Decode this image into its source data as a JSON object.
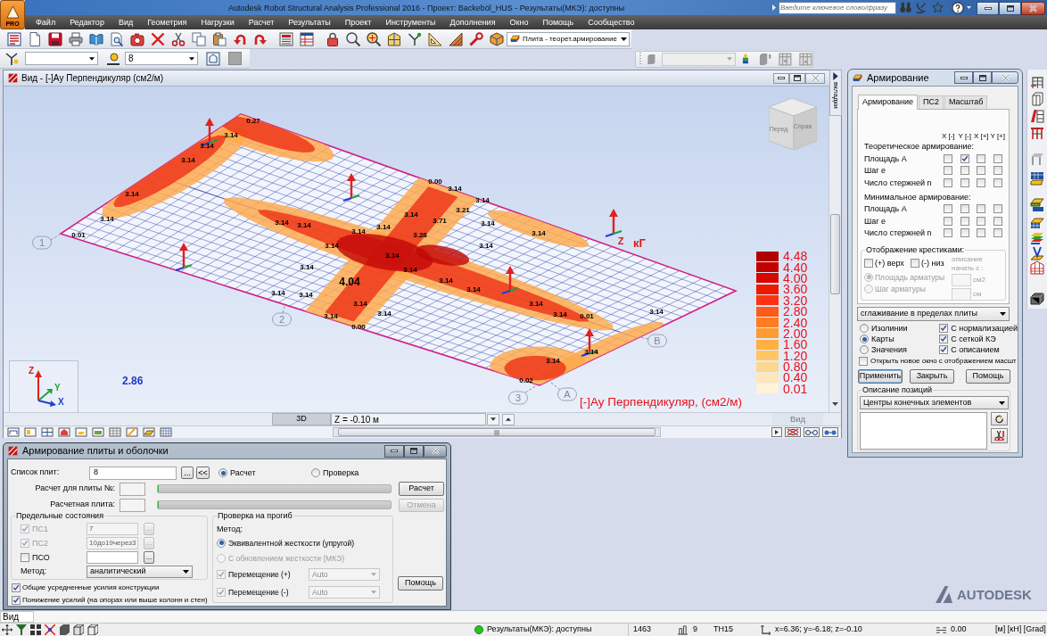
{
  "app": {
    "menu_button": "PRO",
    "title": "Autodesk Robot Structural Analysis Professional 2016 - Проект: Backeböl_HUS - Результаты(МКЭ): доступны",
    "search": {
      "placeholder": "Введите ключевое слово/фразу"
    }
  },
  "menu": [
    "Файл",
    "Редактор",
    "Вид",
    "Геометрия",
    "Нагрузки",
    "Расчет",
    "Результаты",
    "Проект",
    "Инструменты",
    "Дополнения",
    "Окно",
    "Помощь",
    "Сообщество"
  ],
  "toolbar": {
    "layout_dropdown": "Плита - теорет.армирование",
    "case_dropdown": "8"
  },
  "viewport": {
    "title": "Вид - [-]Ау Перпендикуляр (см2/м)",
    "side_tab": "вкладки",
    "view_cube": [
      "Перед",
      "Справ"
    ],
    "map_labels": [
      "0.27",
      "3.14",
      "3.14",
      "3.14",
      "0.00",
      "3.14",
      "3.14",
      "3.14",
      "3.14",
      "0.01",
      "3.14",
      "3.14",
      "3.14",
      "3.14",
      "3.14",
      "3.14",
      "3.71",
      "3.21",
      "3.28",
      "3.14",
      "3.14",
      "3.14",
      "3.14",
      "3.14",
      "4.04",
      "3.14",
      "3.14",
      "3.14",
      "3.14",
      "3.14",
      "3.14",
      "3.14",
      "0.00",
      "3.14",
      "3.14",
      "3.14",
      "0.01",
      "3.14",
      "3.14",
      "3.14",
      "0.02"
    ],
    "grid_axes": [
      "1",
      "2",
      "3",
      "A",
      "B"
    ],
    "load_labels": [
      "Z",
      "кГ"
    ],
    "triad": [
      "Z",
      "Y",
      "X"
    ],
    "scale_value": "2.86",
    "legend": {
      "title": "[-]Ау Перпендикуляр, (см2/м)",
      "items": [
        {
          "label": "4.48",
          "color": "#b00000"
        },
        {
          "label": "4.40",
          "color": "#c30000"
        },
        {
          "label": "4.00",
          "color": "#d60800"
        },
        {
          "label": "3.60",
          "color": "#ee1a00"
        },
        {
          "label": "3.20",
          "color": "#ff3312"
        },
        {
          "label": "2.80",
          "color": "#ff5a1c"
        },
        {
          "label": "2.40",
          "color": "#ff7d24"
        },
        {
          "label": "2.00",
          "color": "#ff9a30"
        },
        {
          "label": "1.60",
          "color": "#ffb042"
        },
        {
          "label": "1.20",
          "color": "#ffc662"
        },
        {
          "label": "0.80",
          "color": "#ffd690"
        },
        {
          "label": "0.40",
          "color": "#ffe6b6"
        },
        {
          "label": "0.01",
          "color": "#fff3d8"
        }
      ]
    },
    "mode": "3D",
    "level": "Z = -0.10 м",
    "view_button": "Вид"
  },
  "reinforcement_panel": {
    "title": "Армирование",
    "tabs": [
      {
        "label": "Армирование",
        "selected": true
      },
      {
        "label": "ПС2",
        "selected": false
      },
      {
        "label": "Масштаб",
        "selected": false
      }
    ],
    "columns": [
      "X [-]",
      "Y [-]",
      "X [+]",
      "Y [+]"
    ],
    "sections": [
      {
        "heading": "Теоретическое армирование:",
        "rows": [
          {
            "label": "Площадь А",
            "checks": [
              false,
              true,
              false,
              false
            ]
          },
          {
            "label": "Шаг е",
            "checks": [
              false,
              false,
              false,
              false
            ]
          },
          {
            "label": "Число стержней n",
            "checks": [
              false,
              false,
              false,
              false
            ]
          }
        ]
      },
      {
        "heading": "Минимальное армирование:",
        "rows": [
          {
            "label": "Площадь А",
            "checks": [
              false,
              false,
              false,
              false
            ]
          },
          {
            "label": "Шаг е",
            "checks": [
              false,
              false,
              false,
              false
            ]
          },
          {
            "label": "Число стержней n",
            "checks": [
              false,
              false,
              false,
              false
            ]
          }
        ]
      }
    ],
    "cross_display": {
      "title": "Отображение крестиками:",
      "options": [
        {
          "label": "(+) верх",
          "checked": false
        },
        {
          "label": "(-) низ",
          "checked": false
        }
      ],
      "description_label": "описание начать с :",
      "disabled": true,
      "radios": [
        {
          "label": "Площадь арматуры",
          "selected": true,
          "unit": "см2"
        },
        {
          "label": "Шаг арматуры",
          "selected": false,
          "unit": "см"
        }
      ]
    },
    "smoothing": "сглаживание в пределах плиты",
    "display_modes": [
      {
        "label": "Изолинии",
        "selected": false
      },
      {
        "label": "Карты",
        "selected": true
      },
      {
        "label": "Значения",
        "selected": false
      }
    ],
    "display_options": [
      {
        "label": "С нормализацией",
        "checked": true
      },
      {
        "label": "С сеткой КЭ",
        "checked": true
      },
      {
        "label": "С описанием",
        "checked": true
      }
    ],
    "new_window": {
      "label": "Открыть новое окно с отображением масшт",
      "checked": false
    },
    "buttons": [
      {
        "label": "Применить",
        "focused": true
      },
      {
        "label": "Закрыть",
        "focused": false
      },
      {
        "label": "Помощь",
        "focused": false
      }
    ],
    "positions": {
      "title": "Описание позиций",
      "dropdown": "Центры конечных элементов"
    }
  },
  "plate_dialog": {
    "title": "Армирование плиты и оболочки",
    "plate_list": {
      "label": "Список плит:",
      "value": "8",
      "browse": "...",
      "pick": "<<"
    },
    "mode": [
      {
        "label": "Расчет",
        "selected": true
      },
      {
        "label": "Проверка",
        "selected": false
      }
    ],
    "progress": [
      {
        "label": "Расчет для плиты №:",
        "level": 0,
        "action": "Расчет",
        "disabled": false
      },
      {
        "label": "Расчетная плита:",
        "level": 0,
        "action": "Отмена",
        "disabled": true
      }
    ],
    "limit_states": {
      "title": "Предельные состояния",
      "rows": [
        {
          "label": "ПС1",
          "checked": true,
          "disabled": true,
          "value": "7",
          "browse": "..."
        },
        {
          "label": "ПС2",
          "checked": true,
          "disabled": true,
          "value": "10до19через3",
          "browse": "..."
        },
        {
          "label": "ПСО",
          "checked": false,
          "disabled": false,
          "browse": "..."
        }
      ],
      "method_label": "Метод:",
      "method": "аналитический"
    },
    "options": [
      {
        "label": "Общие усредненные усилия конструкции",
        "checked": true
      },
      {
        "label": "Понижение усилий (на опорах или выше колонн и стен)",
        "checked": true
      }
    ],
    "deflection": {
      "title": "Проверка на прогиб",
      "method_label": "Метод:",
      "methods": [
        {
          "label": "Эквивалентной жесткости (упругой)",
          "selected": true,
          "disabled": false
        },
        {
          "label": "С обновлением жесткости (МКЭ)",
          "selected": false,
          "disabled": true
        }
      ],
      "displacements": [
        {
          "label": "Перемещение (+)",
          "checked": true,
          "disabled": true,
          "value": "Auto"
        },
        {
          "label": "Перемещение (-)",
          "checked": true,
          "disabled": true,
          "value": "Auto"
        }
      ]
    },
    "help": "Помощь"
  },
  "brand": "AUTODESK",
  "command_line": "Вид",
  "status_bar": {
    "status": "Результаты(МКЭ): доступны",
    "node_count": "1463",
    "case": "9",
    "section": "TH15",
    "coordinates": "x=6.36; y=-6.18; z=-0.10",
    "angle": "0.00",
    "units": "[м] [кН] [Grad]"
  }
}
